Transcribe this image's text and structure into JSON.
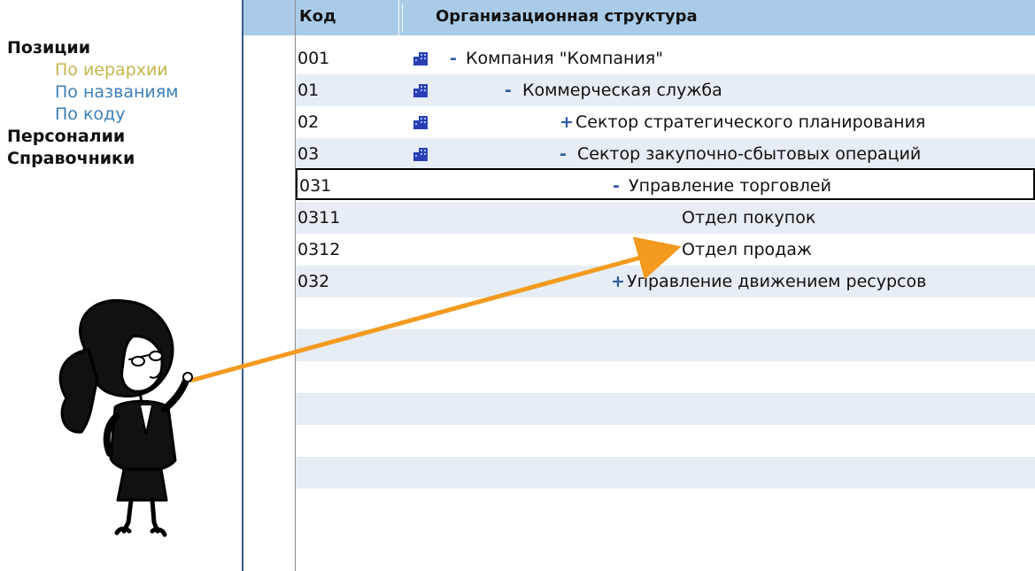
{
  "nav": {
    "positions": "Позиции",
    "by_hierarchy": "По иерархии",
    "by_names": "По названиям",
    "by_code": "По коду",
    "personal": "Персоналии",
    "references": "Справочники"
  },
  "table": {
    "headers": {
      "code": "Код",
      "org": "Организационная структура"
    },
    "rows": [
      {
        "code": "001",
        "sign": "-",
        "name": "Компания \"Компания\"",
        "icon": "building-icon"
      },
      {
        "code": "01",
        "sign": "-",
        "name": "Коммерческая служба",
        "icon": "building-icon"
      },
      {
        "code": "02",
        "sign": "+",
        "name": "Сектор стратегического планирования",
        "icon": "building-icon"
      },
      {
        "code": "03",
        "sign": "-",
        "name": "Сектор закупочно-сбытовых операций",
        "icon": "building-icon"
      },
      {
        "code": "031",
        "sign": "-",
        "name": "Управление торговлей",
        "icon": ""
      },
      {
        "code": "0311",
        "sign": "",
        "name": "Отдел покупок",
        "icon": ""
      },
      {
        "code": "0312",
        "sign": "",
        "name": "Отдел продаж",
        "icon": ""
      },
      {
        "code": "032",
        "sign": "+",
        "name": "Управление движением ресурсов",
        "icon": ""
      }
    ]
  },
  "colors": {
    "header_bg": "#a9cbe8",
    "row_alt": "#e6edf4",
    "active_link": "#c4b64a",
    "link": "#3d7fb7",
    "arrow": "#f39a1f",
    "icon_blue": "#2a3fb6"
  },
  "illustration": {
    "name": "cartoon-woman-pointing",
    "arrow_target_row_code": "0312"
  }
}
